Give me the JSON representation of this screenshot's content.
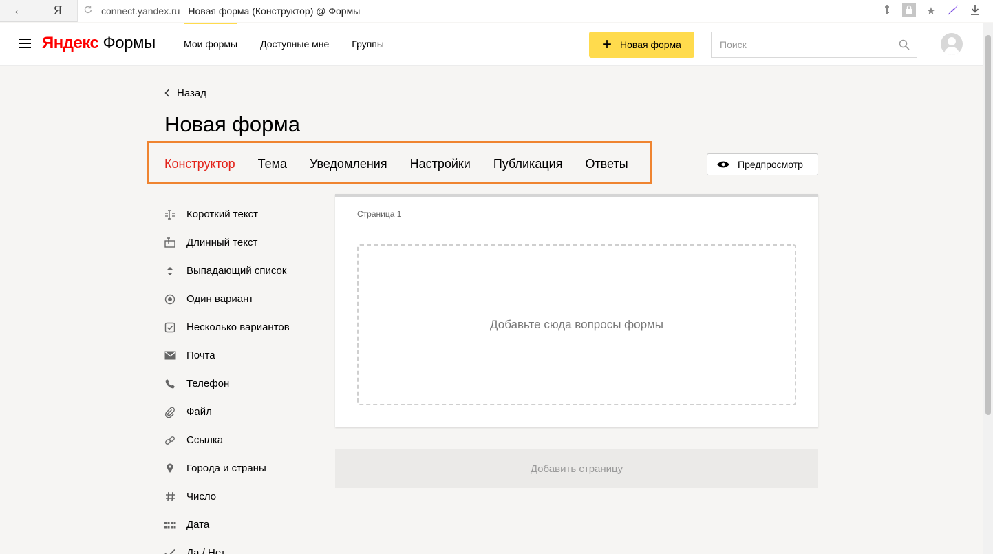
{
  "browser": {
    "back_icon": "←",
    "yandex_icon": "Я",
    "domain": "connect.yandex.ru",
    "page_title": "Новая форма (Конструктор) @ Формы",
    "icons": [
      "key-icon",
      "lock-icon",
      "star-icon",
      "feather-icon",
      "download-icon"
    ]
  },
  "header": {
    "logo_brand": "Яндекс",
    "logo_service": "Формы",
    "nav": [
      {
        "label": "Мои формы",
        "active": true
      },
      {
        "label": "Доступные мне",
        "active": false
      },
      {
        "label": "Группы",
        "active": false
      }
    ],
    "new_form_label": "Новая форма",
    "search_placeholder": "Поиск"
  },
  "main": {
    "back_label": "Назад",
    "title": "Новая форма",
    "tabs": [
      {
        "label": "Конструктор",
        "active": true
      },
      {
        "label": "Тема",
        "active": false
      },
      {
        "label": "Уведомления",
        "active": false
      },
      {
        "label": "Настройки",
        "active": false
      },
      {
        "label": "Публикация",
        "active": false
      },
      {
        "label": "Ответы",
        "active": false
      }
    ],
    "preview_label": "Предпросмотр",
    "fields": [
      {
        "label": "Короткий текст",
        "icon": "short-text-icon"
      },
      {
        "label": "Длинный текст",
        "icon": "long-text-icon"
      },
      {
        "label": "Выпадающий список",
        "icon": "dropdown-icon"
      },
      {
        "label": "Один вариант",
        "icon": "radio-icon"
      },
      {
        "label": "Несколько вариантов",
        "icon": "checkbox-icon"
      },
      {
        "label": "Почта",
        "icon": "mail-icon"
      },
      {
        "label": "Телефон",
        "icon": "phone-icon"
      },
      {
        "label": "Файл",
        "icon": "paperclip-icon"
      },
      {
        "label": "Ссылка",
        "icon": "link-icon"
      },
      {
        "label": "Города и страны",
        "icon": "location-pin-icon"
      },
      {
        "label": "Число",
        "icon": "hash-icon"
      },
      {
        "label": "Дата",
        "icon": "calendar-grid-icon"
      },
      {
        "label": "Да / Нет",
        "icon": "checkmark-icon"
      }
    ],
    "page_label": "Страница 1",
    "dropzone_text": "Добавьте сюда вопросы формы",
    "add_page_label": "Добавить страницу"
  },
  "colors": {
    "accent_yellow": "#ffdb4d",
    "active_tab_red": "#e3231a",
    "highlight_orange": "#ef8430",
    "logo_red": "#ff0000"
  }
}
